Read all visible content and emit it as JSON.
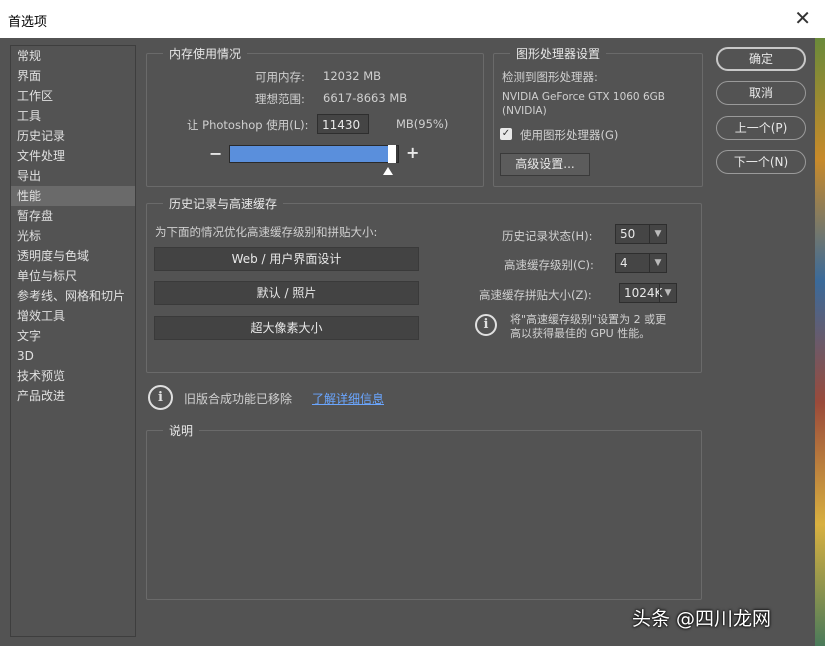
{
  "window": {
    "title": "首选项",
    "close_glyph": "✕"
  },
  "sidebar": {
    "items": [
      "常规",
      "界面",
      "工作区",
      "工具",
      "历史记录",
      "文件处理",
      "导出",
      "性能",
      "暂存盘",
      "光标",
      "透明度与色域",
      "单位与标尺",
      "参考线、网格和切片",
      "增效工具",
      "文字",
      "3D",
      "技术预览",
      "产品改进"
    ],
    "selected": "性能"
  },
  "memory": {
    "legend": "内存使用情况",
    "available_label": "可用内存:",
    "available_value": "12032 MB",
    "ideal_label": "理想范围:",
    "ideal_value": "6617-8663 MB",
    "let_label": "让 Photoshop 使用(L):",
    "input_value": "11430",
    "percent_text": "MB(95%)",
    "usage_fraction": 0.95,
    "minus": "−",
    "plus": "+"
  },
  "gpu": {
    "legend": "图形处理器设置",
    "detected_label": "检测到图形处理器:",
    "gpu_name": "NVIDIA GeForce GTX 1060 6GB",
    "gpu_vendor": "(NVIDIA)",
    "use_gpu_label": "使用图形处理器(G)",
    "use_gpu_checked": true,
    "advanced_button": "高级设置..."
  },
  "history": {
    "legend": "历史记录与高速缓存",
    "optimize_label": "为下面的情况优化高速缓存级别和拼贴大小:",
    "btn_web": "Web / 用户界面设计",
    "btn_default": "默认 / 照片",
    "btn_huge": "超大像素大小",
    "states_label": "历史记录状态(H):",
    "states_value": "50",
    "cache_levels_label": "高速缓存级别(C):",
    "cache_levels_value": "4",
    "tile_size_label": "高速缓存拼贴大小(Z):",
    "tile_size_value": "1024K",
    "tip_line1": "将\"高速缓存级别\"设置为 2 或更",
    "tip_line2": "高以获得最佳的 GPU 性能。"
  },
  "legacy": {
    "text": "旧版合成功能已移除",
    "link": "了解详细信息"
  },
  "description": {
    "legend": "说明"
  },
  "buttons": {
    "ok": "确定",
    "cancel": "取消",
    "prev": "上一个(P)",
    "next": "下一个(N)"
  },
  "watermark": "头条 @四川龙网"
}
